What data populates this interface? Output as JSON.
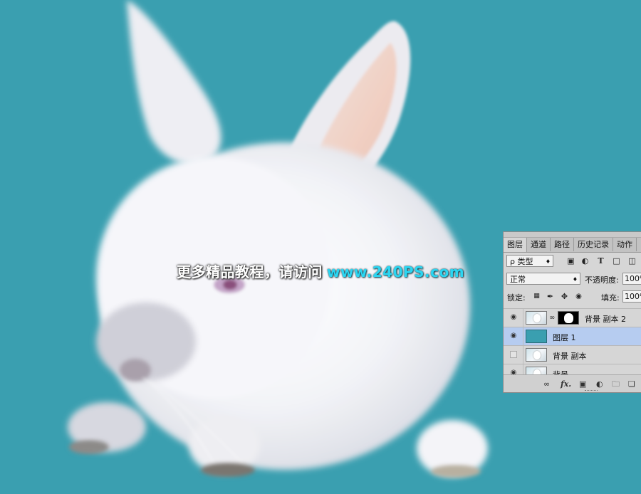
{
  "watermark": {
    "chinese": "更多精品教程，请访问",
    "url": "www.240PS.com"
  },
  "colors": {
    "canvas_background": "#3a9fb0",
    "watermark_url": "#2bd6f2",
    "selected_layer": "#b6ccf0"
  },
  "panel": {
    "tabs": [
      "图层",
      "通道",
      "路径",
      "历史记录",
      "动作"
    ],
    "active_tab": "图层",
    "filter": {
      "icon": "search-icon",
      "label": "ρ 类型"
    },
    "filter_icons": [
      "image-filter-icon",
      "adjustment-filter-icon",
      "type-filter-icon",
      "shape-filter-icon",
      "smart-object-filter-icon"
    ],
    "blend_mode": "正常",
    "opacity_label": "不透明度:",
    "opacity_value": "100%",
    "lock_label": "锁定:",
    "fill_label": "填充:",
    "fill_value": "100%",
    "layers": [
      {
        "name": "背景 副本 2",
        "visible": true,
        "has_mask": true,
        "selected": false
      },
      {
        "name": "图层 1",
        "visible": true,
        "has_mask": false,
        "selected": true
      },
      {
        "name": "背景 副本",
        "visible": false,
        "has_mask": false,
        "selected": false
      },
      {
        "name": "背景",
        "visible": true,
        "has_mask": false,
        "selected": false
      }
    ],
    "bottom_icons": [
      "link-icon",
      "fx-icon",
      "add-mask-icon",
      "adjustment-layer-icon",
      "new-group-icon",
      "new-layer-icon"
    ],
    "fx_label": "fx."
  }
}
